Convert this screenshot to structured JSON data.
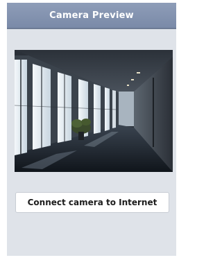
{
  "header": {
    "title": "Camera Preview"
  },
  "preview": {
    "image_subject": "office-corridor-with-windows"
  },
  "actions": {
    "connect_label": "Connect camera to Internet"
  },
  "colors": {
    "title_bar": "#8090ab",
    "screen_background": "#dfe3e9",
    "button_background": "#ffffff"
  }
}
